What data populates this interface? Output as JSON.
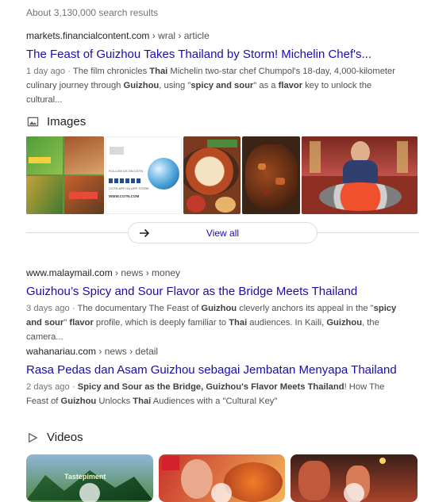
{
  "results_count": "About 3,130,000 search results",
  "results": [
    {
      "site": "markets.financialcontent.com",
      "path": " › wral › article",
      "title": "The Feast of Guizhou Takes Thailand by Storm! Michelin Chef's...",
      "date": "1 day ago",
      "snippet_parts": [
        {
          "t": "The film chronicles ",
          "b": false
        },
        {
          "t": "Thai",
          "b": true
        },
        {
          "t": " Michelin two-star chef Chumpol's 18-day, 4,000-kilometer culinary journey through ",
          "b": false
        },
        {
          "t": "Guizhou",
          "b": true
        },
        {
          "t": ", using \"",
          "b": false
        },
        {
          "t": "spicy and sour",
          "b": true
        },
        {
          "t": "\" as a ",
          "b": false
        },
        {
          "t": "flavor",
          "b": true
        },
        {
          "t": " key to unlock the cultural...",
          "b": false
        }
      ]
    },
    {
      "site": "www.malaymail.com",
      "path": " › news › money",
      "title": "Guizhou’s Spicy and Sour Flavor as the Bridge Meets Thailand",
      "date": "3 days ago",
      "snippet_parts": [
        {
          "t": "The documentary The Feast of ",
          "b": false
        },
        {
          "t": "Guizhou",
          "b": true
        },
        {
          "t": " cleverly anchors its appeal in the \"",
          "b": false
        },
        {
          "t": "spicy and sour",
          "b": true
        },
        {
          "t": "\" ",
          "b": false
        },
        {
          "t": "flavor",
          "b": true
        },
        {
          "t": " profile, which is deeply familiar to ",
          "b": false
        },
        {
          "t": "Thai",
          "b": true
        },
        {
          "t": " audiences. In Kaili, ",
          "b": false
        },
        {
          "t": "Guizhou",
          "b": true
        },
        {
          "t": ", the camera...",
          "b": false
        }
      ]
    },
    {
      "site": "wahanariau.com",
      "path": " › news › detail",
      "title": "Rasa Pedas dan Asam Guizhou sebagai Jembatan Menyapa Thailand",
      "date": "2 days ago",
      "snippet_parts": [
        {
          "t": "Spicy and Sour as the Bridge, Guizhou's Flavor Meets Thailand",
          "b": true
        },
        {
          "t": "! How The Feast of ",
          "b": false
        },
        {
          "t": "Guizhou",
          "b": true
        },
        {
          "t": " Unlocks ",
          "b": false
        },
        {
          "t": "Thai",
          "b": true
        },
        {
          "t": " Audiences with a \"Cultural Key\"",
          "b": false
        }
      ]
    }
  ],
  "images_section": {
    "heading": "Images",
    "view_all": "View all",
    "cgtn_caption_1": "FOLLOW US ON CGTN",
    "cgtn_caption_2": "CGTN APP ON APP STORE",
    "cgtn_url": "WWW.CGTN.COM"
  },
  "videos_section": {
    "heading": "Videos",
    "thumb1_text": "Tastepiment"
  },
  "colors": {
    "link": "#1a0dab",
    "text": "#4d5156",
    "meta": "#70757a",
    "border": "#dadce0"
  }
}
